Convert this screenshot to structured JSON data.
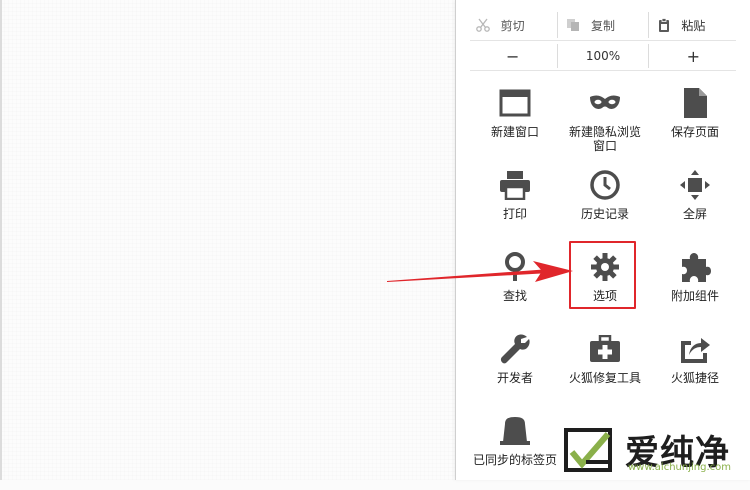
{
  "edit": {
    "cut_label": "剪切",
    "copy_label": "复制",
    "paste_label": "粘贴",
    "cut_icon": "scissors-icon",
    "copy_icon": "copy-icon",
    "paste_icon": "clipboard-icon"
  },
  "zoom": {
    "minus": "−",
    "level": "100%",
    "plus": "+"
  },
  "menu_items": [
    {
      "label": "新建窗口",
      "icon": "new-window-icon"
    },
    {
      "label": "新建隐私浏览\n窗口",
      "icon": "private-mask-icon"
    },
    {
      "label": "保存页面",
      "icon": "save-page-icon"
    },
    {
      "label": "打印",
      "icon": "printer-icon"
    },
    {
      "label": "历史记录",
      "icon": "history-clock-icon"
    },
    {
      "label": "全屏",
      "icon": "fullscreen-icon"
    },
    {
      "label": "查找",
      "icon": "search-icon"
    },
    {
      "label": "选项",
      "icon": "gear-icon"
    },
    {
      "label": "附加组件",
      "icon": "puzzle-icon"
    },
    {
      "label": "开发者",
      "icon": "wrench-icon"
    },
    {
      "label": "火狐修复工具",
      "icon": "first-aid-kit-icon"
    },
    {
      "label": "火狐捷径",
      "icon": "share-icon"
    },
    {
      "label": "已同步的标签页",
      "icon": "synced-tabs-icon"
    }
  ],
  "watermark": {
    "brand": "爱纯净",
    "url": "www.aichunjing.com",
    "accent_color": "#8ab04a"
  },
  "colors": {
    "icon_gray": "#4d4d4d",
    "highlight_red": "#e0262b"
  }
}
